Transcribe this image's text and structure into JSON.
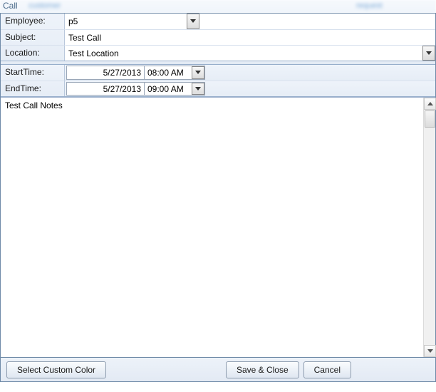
{
  "title": "Call",
  "labels": {
    "employee": "Employee:",
    "subject": "Subject:",
    "location": "Location:",
    "startTime": "StartTime:",
    "endTime": "EndTime:"
  },
  "values": {
    "employee": "p5",
    "subject": "Test Call",
    "location": "Test Location",
    "startDate": "5/27/2013",
    "startTime": "08:00 AM",
    "endDate": "5/27/2013",
    "endTime": "09:00 AM",
    "notes": "Test Call Notes"
  },
  "buttons": {
    "selectColor": "Select Custom Color",
    "saveClose": "Save & Close",
    "cancel": "Cancel"
  }
}
